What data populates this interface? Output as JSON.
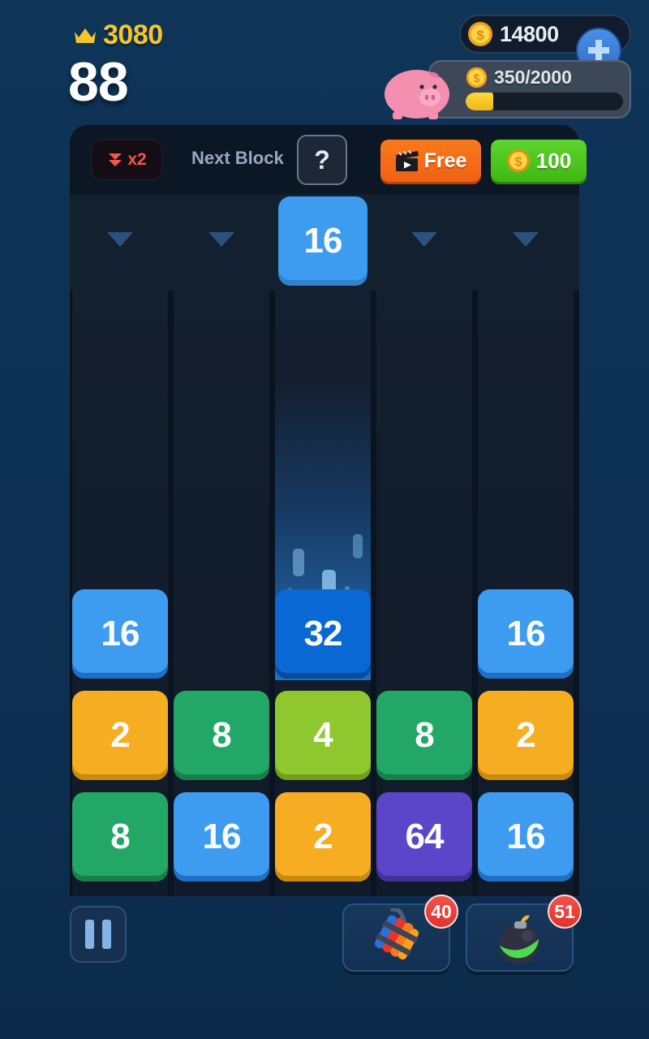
{
  "hud": {
    "crown_icon": "crown-icon",
    "high_score": "3080",
    "level": "88",
    "coin_icon": "coin-icon",
    "coins": "14800",
    "add_coins_icon": "plus-icon",
    "piggy_icon": "piggy-bank-icon",
    "piggy_progress_text": "350/2000",
    "piggy_percent": 17.5
  },
  "topbar": {
    "multiplier_icon": "double-chevron-down-icon",
    "multiplier_label": "x2",
    "next_block_label": "Next Block",
    "next_block_value": "?",
    "free_icon": "video-clapperboard-icon",
    "free_label": "Free",
    "cost_icon": "coin-icon",
    "cost_label": "100"
  },
  "launcher": {
    "arrow_icon": "chevron-down-icon",
    "arrow_columns": [
      0,
      1,
      3,
      4
    ],
    "active_column": 2,
    "active_value": "16",
    "active_color": "#3d9bf0"
  },
  "board": {
    "columns": 5,
    "trail_column": 2,
    "rows": [
      [
        {
          "value": "16",
          "color": "#3d9bf0",
          "shadow": "#1f6fc4"
        },
        null,
        {
          "value": "32",
          "color": "#0a68d4",
          "shadow": "#064c9e"
        },
        null,
        {
          "value": "16",
          "color": "#3d9bf0",
          "shadow": "#1f6fc4"
        }
      ],
      [
        {
          "value": "2",
          "color": "#f6ad22",
          "shadow": "#cc8a0d"
        },
        {
          "value": "8",
          "color": "#23a766",
          "shadow": "#178049"
        },
        {
          "value": "4",
          "color": "#8fc72e",
          "shadow": "#6da01c"
        },
        {
          "value": "8",
          "color": "#23a766",
          "shadow": "#178049"
        },
        {
          "value": "2",
          "color": "#f6ad22",
          "shadow": "#cc8a0d"
        }
      ],
      [
        {
          "value": "8",
          "color": "#23a766",
          "shadow": "#178049"
        },
        {
          "value": "16",
          "color": "#3d9bf0",
          "shadow": "#1f6fc4"
        },
        {
          "value": "2",
          "color": "#f6ad22",
          "shadow": "#cc8a0d"
        },
        {
          "value": "64",
          "color": "#5b45c9",
          "shadow": "#42309c"
        },
        {
          "value": "16",
          "color": "#3d9bf0",
          "shadow": "#1f6fc4"
        }
      ]
    ]
  },
  "bottom": {
    "pause_icon": "pause-icon",
    "powerups": [
      {
        "icon": "dynamite-icon",
        "count": "40"
      },
      {
        "icon": "bomb-icon",
        "count": "51"
      }
    ]
  },
  "colors": {
    "background": "#0d3155",
    "panel": "#0b1524",
    "gold": "#f7c52b",
    "accent_blue": "#3d9bf0",
    "badge_red": "#e0322c"
  }
}
